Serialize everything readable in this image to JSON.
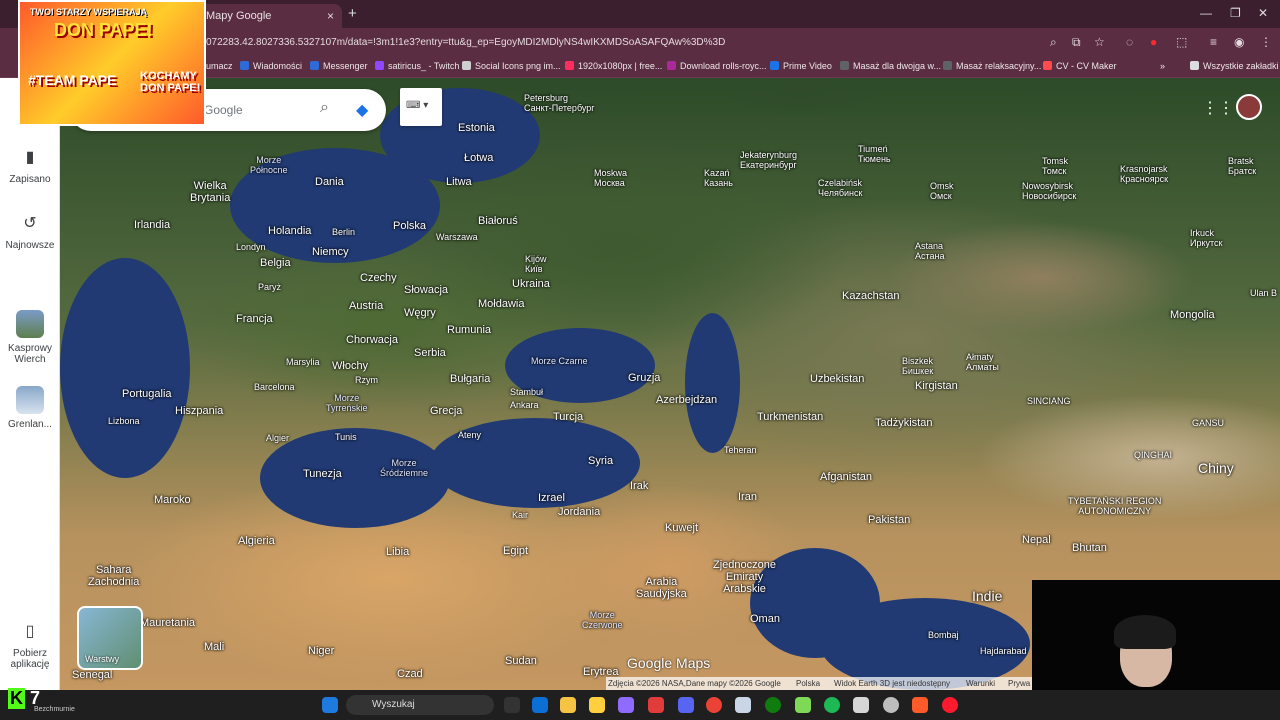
{
  "browser": {
    "tab_title": "Mapy Google",
    "url": "072283.42.8027336.5327107m/data=!3m1!1e3?entry=ttu&g_ep=EgoyMDI2MDlyNS4wIKXMDSoASAFQAw%3D%3D",
    "bookmarks": [
      "umacz",
      "Wiadomości",
      "Messenger",
      "satiricus_ - Twitch",
      "Social Icons png im...",
      "1920x1080px | free...",
      "Download rolls-royc...",
      "Prime Video",
      "Masaż dla dwojga w...",
      "Masaż relaksacyjny...",
      "CV - CV Maker",
      "Wszystkie zakładki"
    ],
    "bookmark_colors": [
      "#9aa0a6",
      "#2f6bd8",
      "#2f6bd8",
      "#9146ff",
      "#d0d0d0",
      "#ff2e5f",
      "#aa2a99",
      "#1a73e8",
      "#5f6368",
      "#5f6368",
      "#ff4b4b",
      "#dadce0"
    ]
  },
  "promo": {
    "title": "TWOI STARZY WSPIERAJĄ",
    "don": "DON PAPE!",
    "team": "#TEAM PAPE",
    "love": "KOCHAMY DON PAPE!"
  },
  "search": {
    "placeholder": "Google"
  },
  "rail": {
    "saved": "Zapisano",
    "recent": "Najnowsze",
    "place1": "Kasprowy Wierch",
    "place2": "Grenlan...",
    "download": "Pobierz aplikację"
  },
  "map": {
    "labels": {
      "petersburg": "Petersburg\nСанкт-Петербург",
      "estonia": "Estonia",
      "morze_polnocne": "Morze\nPółnocne",
      "dania": "Dania",
      "lotwa": "Łotwa",
      "litwa": "Litwa",
      "moskwa": "Moskwa\nМосква",
      "kazan": "Kazań\nКазань",
      "jekaterynburg": "Jekaterynburg\nЕкатеринбург",
      "tiumen": "Tiumeń\nТюмень",
      "tomsk": "Tomsk\nТомск",
      "krasnojarsk": "Krasnojarsk\nКрасноярск",
      "bratsk": "Bratsk\nБратск",
      "wielka_brytania": "Wielka\nBrytania",
      "irlandia": "Irlandia",
      "holandia": "Holandia",
      "berlin": "Berlin",
      "polska": "Polska",
      "bialorus": "Białoruś",
      "warszawa": "Warszawa",
      "czelabinsk": "Czelabińsk\nЧелябинск",
      "omsk": "Omsk\nОмск",
      "nowosybirsk": "Nowosybirsk\nНовосибирск",
      "irkuck": "Irkuck\nИркутск",
      "londyn": "Londyn",
      "belgia": "Belgia",
      "niemcy": "Niemcy",
      "kijow": "Kijów\nКиїв",
      "ukraina": "Ukraina",
      "astana": "Astana\nАстана",
      "ulan_bator": "Ulan B",
      "paryz": "Paryż",
      "czechy": "Czechy",
      "slowacja": "Słowacja",
      "moldawia": "Mołdawia",
      "kazachstan": "Kazachstan",
      "mongolia": "Mongolia",
      "francja": "Francja",
      "austria": "Austria",
      "wegry": "Węgry",
      "rumunia": "Rumunia",
      "chorwacja": "Chorwacja",
      "serbia": "Serbia",
      "biszkek": "Biszkek\nБишкек",
      "almaty": "Ałmaty\nАлматы",
      "marsylia": "Marsylia",
      "wlochy": "Włochy",
      "rzym": "Rzym",
      "morze_czarne": "Morze Czarne",
      "gruzja": "Gruzja",
      "uzbekistan": "Uzbekistan",
      "kirgistan": "Kirgistan",
      "portugalia": "Portugalia",
      "barcelona": "Barcelona",
      "bulgaria": "Bułgaria",
      "stambul": "Stambuł",
      "ankara": "Ankara",
      "azerbejdzan": "Azerbejdżan",
      "lizbona": "Lizbona",
      "hiszpania": "Hiszpania",
      "morze_tyrrenskie": "Morze\nTyrreńskie",
      "grecja": "Grecja",
      "turcja": "Turcja",
      "turkmenistan": "Turkmenistan",
      "tadzykistan": "Tadżykistan",
      "sinciang": "SINCIANG",
      "algier": "Algier",
      "tunis": "Tunis",
      "ateny": "Ateny",
      "teheran": "Teheran",
      "gansu": "GANSU",
      "qinghai": "QINGHAI",
      "tunezja": "Tunezja",
      "morze_srodziemne": "Morze\nŚródziemne",
      "syria": "Syria",
      "chiny": "Chiny",
      "afganistan": "Afganistan",
      "maroko": "Maroko",
      "irak": "Irak",
      "iran": "Iran",
      "izrael": "Izrael",
      "kair": "Kair",
      "jordania": "Jordania",
      "pakistan": "Pakistan",
      "tibet": "TYBETAŃSKI REGION\nAUTONOMICZNY",
      "algieria": "Algieria",
      "libia": "Libia",
      "egipt": "Egipt",
      "kuwejt": "Kuwejt",
      "nepal": "Nepal",
      "bhutan": "Bhutan",
      "sahara": "Sahara\nZachodnia",
      "zjednoczone": "Zjednoczone\nEmiraty\nArabskie",
      "arabia": "Arabia\nSaudyjska",
      "indie": "Indie",
      "mauretania": "Mauretania",
      "mali": "Mali",
      "niger": "Niger",
      "sudan": "Sudan",
      "oman": "Oman",
      "bombaj": "Bombaj",
      "senegal": "Senegal",
      "czad": "Czad",
      "erytrea": "Erytrea",
      "morze_czerwone": "Morze\nCzerwone",
      "hajdarabad": "Hajdarabad"
    }
  },
  "layers": {
    "label": "Warstwy"
  },
  "footer": {
    "google_maps": "Google Maps",
    "imagery": "Zdjęcia ©2026 NASA,Dane mapy ©2026 Google",
    "region": "Polska",
    "earth3d": "Widok Earth 3D jest niedostępny",
    "terms": "Warunki",
    "privacy": "Prywa"
  },
  "taskbar": {
    "search_label": "Wyszukaj",
    "icon_colors": [
      "#1f7ae0",
      "#333333",
      "#0b6fd6",
      "#f6c344",
      "#ffcf3d",
      "#8f6bff",
      "#e23b3b",
      "#5865f2",
      "#ea4335",
      "#c8d6e5",
      "#107c10",
      "#7ed957",
      "#1db954",
      "#d6d6d6",
      "#bdbdbd",
      "#ff5a2a",
      "#ff1b2d"
    ]
  },
  "kick": {
    "big": "7",
    "sub": "Bezchmurnie"
  }
}
